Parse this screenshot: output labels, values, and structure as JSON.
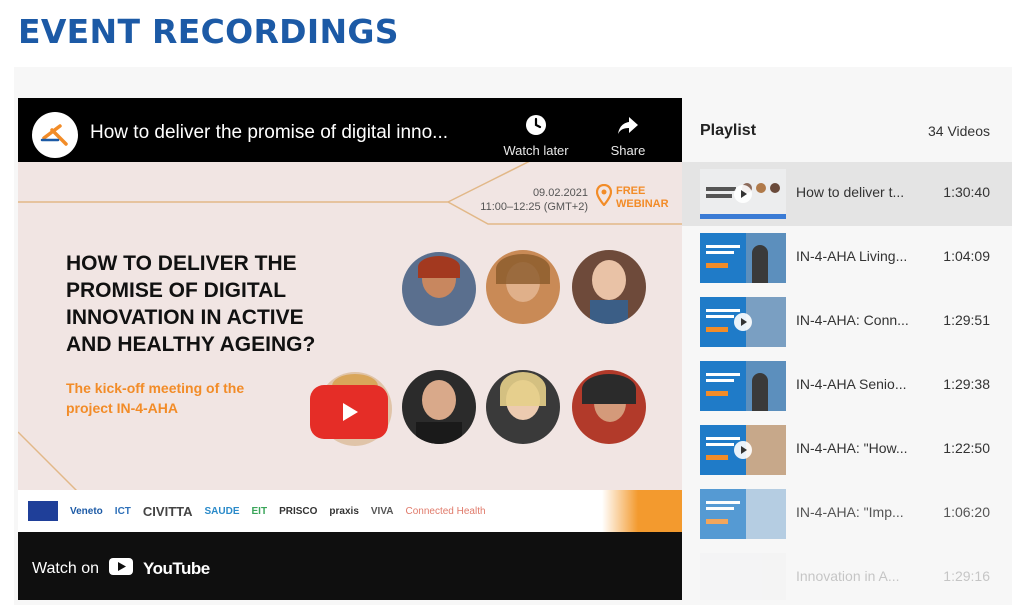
{
  "page": {
    "title": "EVENT RECORDINGS"
  },
  "player": {
    "video_title": "How to deliver the promise of digital inno...",
    "watch_later_label": "Watch later",
    "share_label": "Share",
    "watch_on_label": "Watch on",
    "youtube_wordmark": "YouTube",
    "thumbnail": {
      "date": "09.02.2021",
      "time": "11:00–12:25 (GMT+2)",
      "badge": "FREE\nWEBINAR",
      "headline": "HOW TO DELIVER THE PROMISE OF DIGITAL INNOVATION IN ACTIVE AND HEALTHY AGEING?",
      "subline": "The kick-off meeting of the project IN-4-AHA",
      "logos": [
        "Veneto",
        "ICT",
        "CIVITTA",
        "SAUDE",
        "EIT",
        "PRISCO",
        "praxis",
        "VIVA",
        "Connected Health"
      ],
      "accent_color": "#f28c28"
    }
  },
  "playlist": {
    "title": "Playlist",
    "count": "34 Videos",
    "items": [
      {
        "title": "How to deliver t...",
        "duration": "1:30:40"
      },
      {
        "title": "IN-4-AHA Living...",
        "duration": "1:04:09"
      },
      {
        "title": "IN-4-AHA: Conn...",
        "duration": "1:29:51"
      },
      {
        "title": "IN-4-AHA Senio...",
        "duration": "1:29:38"
      },
      {
        "title": "IN-4-AHA: \"How...",
        "duration": "1:22:50"
      },
      {
        "title": "IN-4-AHA: \"Imp...",
        "duration": "1:06:20"
      },
      {
        "title": "Innovation in A...",
        "duration": "1:29:16"
      }
    ]
  },
  "colors": {
    "title_blue": "#1c5aa6",
    "yt_red": "#e52d27",
    "active_row": "#e4e4e4"
  }
}
